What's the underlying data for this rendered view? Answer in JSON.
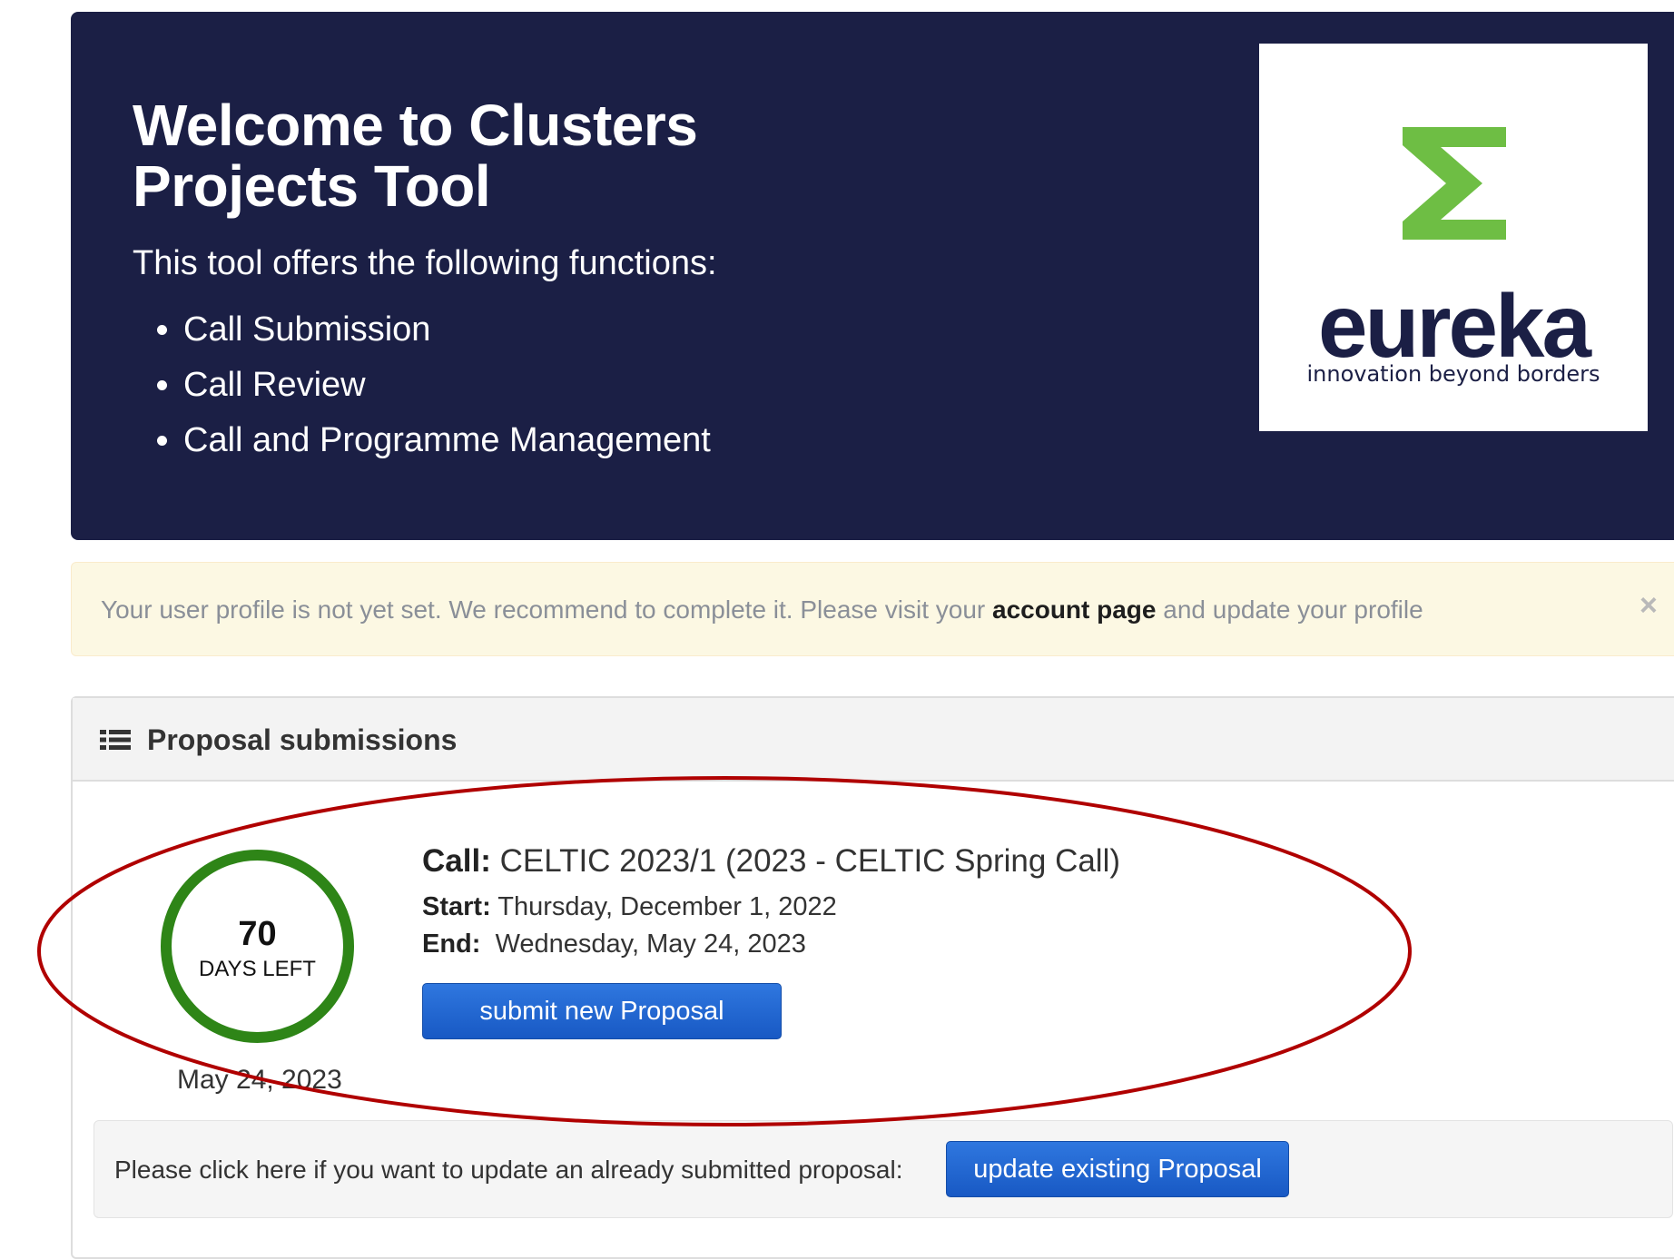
{
  "hero": {
    "title": "Welcome to Clusters Projects Tool",
    "intro": "This tool offers the following functions:",
    "functions": [
      "Call Submission",
      "Call Review",
      "Call and Programme Management"
    ],
    "logo": {
      "wordmark": "eureka",
      "tagline": "innovation beyond borders",
      "symbol": "sigma-icon",
      "symbol_color": "#6ebe44"
    }
  },
  "alert": {
    "text_before": "Your user profile is not yet set. We recommend to complete it. Please visit your",
    "link": "account page",
    "text_after": "and update your profile",
    "close": "×"
  },
  "proposals": {
    "title": "Proposal submissions",
    "icon": "list-icon",
    "countdown": {
      "days": "70",
      "label": "DAYS LEFT",
      "date": "May 24, 2023",
      "color": "#2e8517"
    },
    "call": {
      "call_label": "Call:",
      "call_value": "CELTIC 2023/1 (2023 - CELTIC Spring Call)",
      "start_label": "Start:",
      "start_value": "Thursday, December 1, 2022",
      "end_label": "End:",
      "end_value": "Wednesday, May 24, 2023"
    },
    "submit_button": "submit new Proposal",
    "update_prompt": "Please click here if you want to update an already submitted proposal:",
    "update_button": "update existing Proposal"
  },
  "highlight_color": "#b00000"
}
